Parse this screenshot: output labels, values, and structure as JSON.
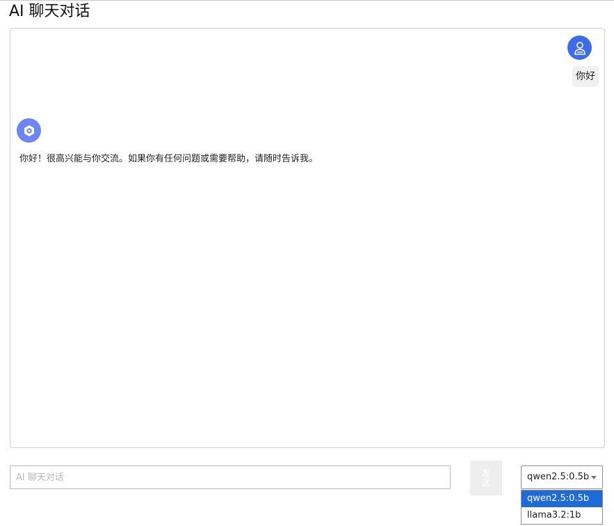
{
  "page": {
    "title": "AI 聊天对话"
  },
  "chat": {
    "messages": [
      {
        "role": "user",
        "avatar_icon": "user-icon",
        "text": "你好"
      },
      {
        "role": "assistant",
        "avatar_icon": "ai-bot-icon",
        "text": "你好！很高兴能与你交流。如果你有任何问题或需要帮助，请随时告诉我。"
      }
    ]
  },
  "composer": {
    "placeholder": "AI 聊天对话",
    "value": "",
    "send_label": "发送"
  },
  "model_select": {
    "selected": "qwen2.5:0.5b",
    "options": [
      "qwen2.5:0.5b",
      "llama3.2:1b"
    ]
  },
  "colors": {
    "user_avatar": "#3e6be8",
    "bot_avatar": "#6b86f1",
    "option_highlight": "#1e6ad6"
  }
}
